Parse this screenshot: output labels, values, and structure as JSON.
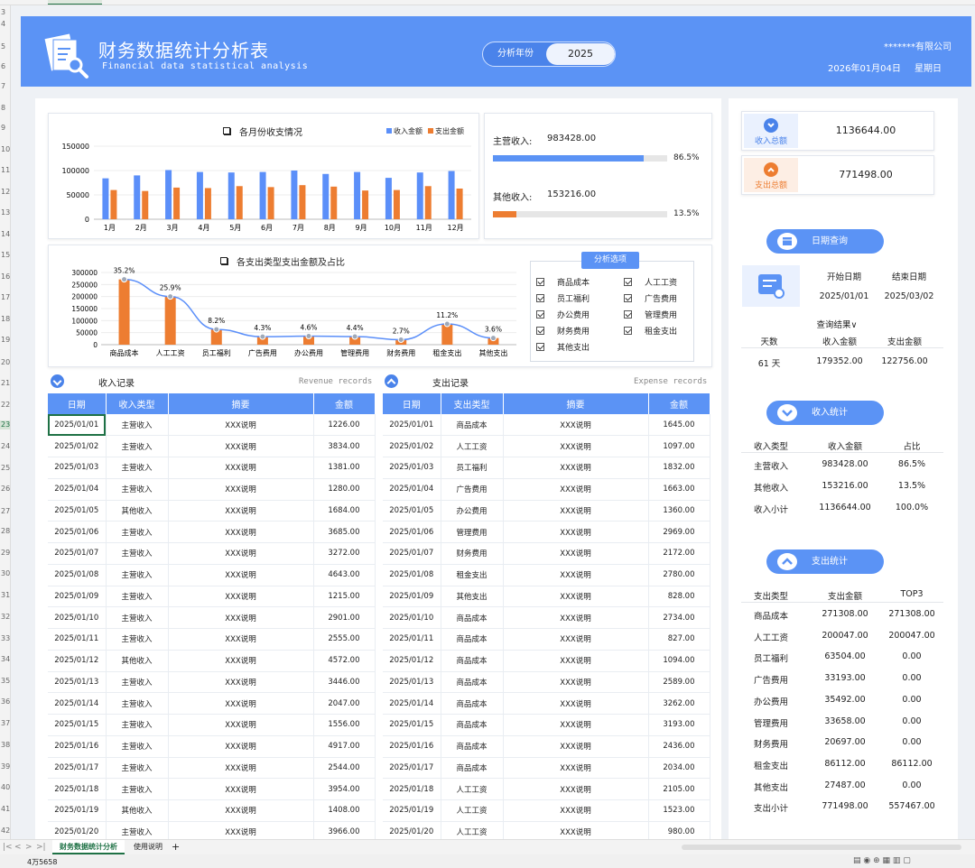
{
  "header": {
    "title": "财务数据统计分析表",
    "subtitle": "Financial data statistical analysis",
    "year_label": "分析年份",
    "year_value": "2025",
    "company": "*******有限公司",
    "date": "2026年01月04日",
    "weekday": "星期日"
  },
  "chart1": {
    "title": "各月份收支情况",
    "legend_income": "收入金额",
    "legend_expense": "支出金额"
  },
  "chart_data": [
    {
      "type": "bar",
      "title": "各月份收支情况",
      "categories": [
        "1月",
        "2月",
        "3月",
        "4月",
        "5月",
        "6月",
        "7月",
        "8月",
        "9月",
        "10月",
        "11月",
        "12月"
      ],
      "series": [
        {
          "name": "收入金额",
          "color": "#5b8ff9",
          "values": [
            84000,
            90000,
            101000,
            97000,
            96000,
            97000,
            100000,
            93000,
            97000,
            85000,
            96000,
            99000
          ]
        },
        {
          "name": "支出金额",
          "color": "#ed7d31",
          "values": [
            60000,
            58000,
            65000,
            64000,
            68000,
            66000,
            70000,
            67000,
            59000,
            60000,
            68000,
            63000
          ]
        }
      ],
      "yticks": [
        "150000",
        "100000",
        "50000",
        "0"
      ],
      "ylim": [
        0,
        150000
      ],
      "grid": true,
      "legend": "top-right"
    },
    {
      "type": "bar",
      "title": "各支出类型支出金额及占比",
      "categories": [
        "商品成本",
        "人工工资",
        "员工福利",
        "广告费用",
        "办公费用",
        "管理费用",
        "财务费用",
        "租金支出",
        "其他支出"
      ],
      "values": [
        271308,
        200047,
        63504,
        33193,
        35492,
        33658,
        20697,
        86112,
        27487
      ],
      "percent_labels": [
        "35.2%",
        "25.9%",
        "8.2%",
        "4.3%",
        "4.6%",
        "4.4%",
        "2.7%",
        "11.2%",
        "3.6%"
      ],
      "percent_values": [
        35.2,
        25.9,
        8.2,
        4.3,
        4.6,
        4.4,
        2.7,
        11.2,
        3.6
      ],
      "yticks": [
        "300000",
        "250000",
        "200000",
        "150000",
        "100000",
        "50000",
        "0"
      ],
      "ylim": [
        0,
        300000
      ],
      "grid": true
    }
  ],
  "chart2": {
    "title": "各支出类型支出金额及占比"
  },
  "progress": {
    "main": {
      "label": "主营收入:",
      "value": "983428.00",
      "percent": "86.5%",
      "fraction": 0.865
    },
    "other": {
      "label": "其他收入:",
      "value": "153216.00",
      "percent": "13.5%",
      "fraction": 0.135
    }
  },
  "options": {
    "button": "分析选项",
    "items": [
      "商品成本",
      "人工工资",
      "员工福利",
      "广告费用",
      "办公费用",
      "管理费用",
      "财务费用",
      "租金支出",
      "其他支出"
    ]
  },
  "revenue": {
    "title": "收入记录",
    "eng": "Revenue records",
    "headers": [
      "日期",
      "收入类型",
      "摘要",
      "金额"
    ],
    "rows": [
      [
        "2025/01/01",
        "主营收入",
        "XXX说明",
        "1226.00"
      ],
      [
        "2025/01/02",
        "主营收入",
        "XXX说明",
        "3834.00"
      ],
      [
        "2025/01/03",
        "主营收入",
        "XXX说明",
        "1381.00"
      ],
      [
        "2025/01/04",
        "主营收入",
        "XXX说明",
        "1280.00"
      ],
      [
        "2025/01/05",
        "其他收入",
        "XXX说明",
        "1684.00"
      ],
      [
        "2025/01/06",
        "主营收入",
        "XXX说明",
        "3685.00"
      ],
      [
        "2025/01/07",
        "主营收入",
        "XXX说明",
        "3272.00"
      ],
      [
        "2025/01/08",
        "主营收入",
        "XXX说明",
        "4643.00"
      ],
      [
        "2025/01/09",
        "主营收入",
        "XXX说明",
        "1215.00"
      ],
      [
        "2025/01/10",
        "主营收入",
        "XXX说明",
        "2901.00"
      ],
      [
        "2025/01/11",
        "主营收入",
        "XXX说明",
        "2555.00"
      ],
      [
        "2025/01/12",
        "其他收入",
        "XXX说明",
        "4572.00"
      ],
      [
        "2025/01/13",
        "主营收入",
        "XXX说明",
        "3446.00"
      ],
      [
        "2025/01/14",
        "主营收入",
        "XXX说明",
        "2047.00"
      ],
      [
        "2025/01/15",
        "主营收入",
        "XXX说明",
        "1556.00"
      ],
      [
        "2025/01/16",
        "主营收入",
        "XXX说明",
        "4917.00"
      ],
      [
        "2025/01/17",
        "主营收入",
        "XXX说明",
        "2544.00"
      ],
      [
        "2025/01/18",
        "主营收入",
        "XXX说明",
        "3954.00"
      ],
      [
        "2025/01/19",
        "其他收入",
        "XXX说明",
        "1408.00"
      ],
      [
        "2025/01/20",
        "主营收入",
        "XXX说明",
        "3966.00"
      ]
    ]
  },
  "expense": {
    "title": "支出记录",
    "eng": "Expense records",
    "headers": [
      "日期",
      "支出类型",
      "摘要",
      "金额"
    ],
    "rows": [
      [
        "2025/01/01",
        "商品成本",
        "XXX说明",
        "1645.00"
      ],
      [
        "2025/01/02",
        "人工工资",
        "XXX说明",
        "1097.00"
      ],
      [
        "2025/01/03",
        "员工福利",
        "XXX说明",
        "1832.00"
      ],
      [
        "2025/01/04",
        "广告费用",
        "XXX说明",
        "1663.00"
      ],
      [
        "2025/01/05",
        "办公费用",
        "XXX说明",
        "1360.00"
      ],
      [
        "2025/01/06",
        "管理费用",
        "XXX说明",
        "2969.00"
      ],
      [
        "2025/01/07",
        "财务费用",
        "XXX说明",
        "2172.00"
      ],
      [
        "2025/01/08",
        "租金支出",
        "XXX说明",
        "2780.00"
      ],
      [
        "2025/01/09",
        "其他支出",
        "XXX说明",
        "828.00"
      ],
      [
        "2025/01/10",
        "商品成本",
        "XXX说明",
        "2734.00"
      ],
      [
        "2025/01/11",
        "商品成本",
        "XXX说明",
        "827.00"
      ],
      [
        "2025/01/12",
        "商品成本",
        "XXX说明",
        "1094.00"
      ],
      [
        "2025/01/13",
        "商品成本",
        "XXX说明",
        "2589.00"
      ],
      [
        "2025/01/14",
        "商品成本",
        "XXX说明",
        "3262.00"
      ],
      [
        "2025/01/15",
        "商品成本",
        "XXX说明",
        "3193.00"
      ],
      [
        "2025/01/16",
        "商品成本",
        "XXX说明",
        "2436.00"
      ],
      [
        "2025/01/17",
        "商品成本",
        "XXX说明",
        "2034.00"
      ],
      [
        "2025/01/18",
        "人工工资",
        "XXX说明",
        "2105.00"
      ],
      [
        "2025/01/19",
        "人工工资",
        "XXX说明",
        "1523.00"
      ],
      [
        "2025/01/20",
        "人工工资",
        "XXX说明",
        "980.00"
      ]
    ]
  },
  "totals": {
    "income_label": "收入总额",
    "income_value": "1136644.00",
    "expense_label": "支出总额",
    "expense_value": "771498.00"
  },
  "date_query": {
    "button": "日期查询",
    "start_label": "开始日期",
    "end_label": "结束日期",
    "start": "2025/01/01",
    "end": "2025/03/02",
    "result_title": "查询结果∨",
    "headers": [
      "天数",
      "收入金额",
      "支出金额"
    ],
    "row": [
      "61 天",
      "179352.00",
      "122756.00"
    ]
  },
  "income_stats": {
    "button": "收入统计",
    "headers": [
      "收入类型",
      "收入金额",
      "占比"
    ],
    "rows": [
      [
        "主营收入",
        "983428.00",
        "86.5%"
      ],
      [
        "其他收入",
        "153216.00",
        "13.5%"
      ],
      [
        "收入小计",
        "1136644.00",
        "100.0%"
      ]
    ]
  },
  "expense_stats": {
    "button": "支出统计",
    "headers": [
      "支出类型",
      "支出金额",
      "TOP3"
    ],
    "rows": [
      [
        "商品成本",
        "271308.00",
        "271308.00"
      ],
      [
        "人工工资",
        "200047.00",
        "200047.00"
      ],
      [
        "员工福利",
        "63504.00",
        "0.00"
      ],
      [
        "广告费用",
        "33193.00",
        "0.00"
      ],
      [
        "办公费用",
        "35492.00",
        "0.00"
      ],
      [
        "管理费用",
        "33658.00",
        "0.00"
      ],
      [
        "财务费用",
        "20697.00",
        "0.00"
      ],
      [
        "租金支出",
        "86112.00",
        "86112.00"
      ],
      [
        "其他支出",
        "27487.00",
        "0.00"
      ],
      [
        "支出小计",
        "771498.00",
        "557467.00"
      ]
    ]
  },
  "sheet_tabs": [
    "财务数据统计分析",
    "使用说明"
  ],
  "tab_add": "+",
  "status": {
    "count": "4万5658"
  },
  "row_numbers": [
    "3",
    "4",
    "5",
    "6",
    "7",
    "8",
    "9",
    "10",
    "11",
    "12",
    "13",
    "14",
    "15",
    "16",
    "17",
    "18",
    "19",
    "20",
    "21",
    "22",
    "23",
    "24",
    "25",
    "26",
    "27",
    "28",
    "29",
    "30",
    "31",
    "32",
    "33",
    "34",
    "35",
    "36",
    "37",
    "38",
    "39",
    "40",
    "41",
    "42"
  ]
}
